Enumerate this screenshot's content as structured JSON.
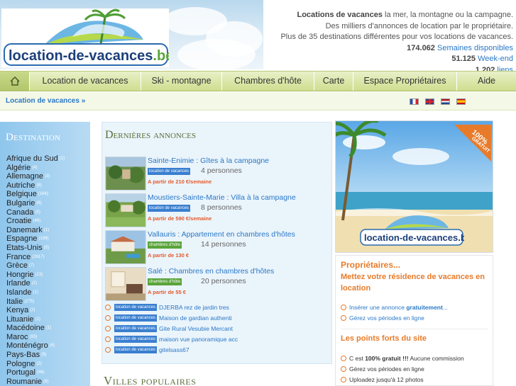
{
  "header": {
    "logo_text": "location-de-vacances.be",
    "tagline_strong": "Locations de vacances",
    "tagline_rest": " la mer, la montagne ou la campagne.",
    "line2": "Des milliers d'annonces de location par le propriétaire.",
    "line3": "Plus de 35 destinations différentes pour vos locations de vacances.",
    "stats": [
      {
        "num": "174.062",
        "label": "Semaines disponibles"
      },
      {
        "num": "51.125",
        "label": "Week-end"
      },
      {
        "num": "1.202",
        "label": "liens"
      }
    ]
  },
  "nav": {
    "home_icon": "home-icon",
    "items": [
      "Location de vacances",
      "Ski - montagne",
      "Chambres d'hôte",
      "Carte",
      "Espace Propriétaires",
      "Aide"
    ]
  },
  "breadcrumb": "Location de vacances »",
  "languages": [
    "fr",
    "en",
    "nl",
    "es"
  ],
  "sidebar": {
    "title": "Destination",
    "destinations": [
      {
        "name": "Afrique du Sud",
        "count": "(1)"
      },
      {
        "name": "Algérie",
        "count": "(4)"
      },
      {
        "name": "Allemagne",
        "count": "(3)"
      },
      {
        "name": "Autriche",
        "count": "(8)"
      },
      {
        "name": "Belgique",
        "count": "(164)"
      },
      {
        "name": "Bulgarie",
        "count": "(6)"
      },
      {
        "name": "Canada",
        "count": "(5)"
      },
      {
        "name": "Croatie",
        "count": "(48)"
      },
      {
        "name": "Danemark",
        "count": "(1)"
      },
      {
        "name": "Espagne",
        "count": "(189)"
      },
      {
        "name": "Etats-Unis",
        "count": "(5)"
      },
      {
        "name": "France",
        "count": "(2617)"
      },
      {
        "name": "Grèce",
        "count": "(7)"
      },
      {
        "name": "Hongrie",
        "count": "(13)"
      },
      {
        "name": "Irlande",
        "count": "(2)"
      },
      {
        "name": "Islande",
        "count": "(1)"
      },
      {
        "name": "Italie",
        "count": "(275)"
      },
      {
        "name": "Kenya",
        "count": "(2)"
      },
      {
        "name": "Lituanie",
        "count": "(1)"
      },
      {
        "name": "Macédoine",
        "count": "(1)"
      },
      {
        "name": "Maroc",
        "count": "(93)"
      },
      {
        "name": "Monténégro",
        "count": "(4)"
      },
      {
        "name": "Pays-Bas",
        "count": "(9)"
      },
      {
        "name": "Pologne",
        "count": "(2)"
      },
      {
        "name": "Portugal",
        "count": "(46)"
      },
      {
        "name": "Roumanie",
        "count": "(6)"
      }
    ]
  },
  "annonces": {
    "title": "Dernières annonces",
    "items": [
      {
        "title": "Sainte-Enimie : Gîtes à la campagne",
        "tag": "location de vacances",
        "persons": "4 personnes",
        "price": "A partir de 210 €/semaine"
      },
      {
        "title": "Moustiers-Sainte-Marie : Villa à la campagne",
        "tag": "location de vacances",
        "persons": "8 personnes",
        "price": "A partir de 590 €/semaine"
      },
      {
        "title": "Vallauris : Appartement en chambres d'hôtes",
        "tag": "chambres d'hôte",
        "persons": "14 personnes",
        "price": "A partir de 130 €"
      },
      {
        "title": "Salé : Chambres en chambres d'hôtes",
        "tag": "chambres d'hôte",
        "persons": "20 personnes",
        "price": "A partir de 55 €"
      }
    ],
    "mini": [
      {
        "tag": "location de vacances",
        "text": "DJERBA rez de jardin tres"
      },
      {
        "tag": "location de vacances",
        "text": "Maison de gardian authenti"
      },
      {
        "tag": "location de vacances",
        "text": "Gite Rural Vesubie Mercant"
      },
      {
        "tag": "location de vacances",
        "text": "maison vue panoramique acc"
      },
      {
        "tag": "location de vacances",
        "text": "gitelsass67"
      }
    ]
  },
  "villes_title": "Villes populaires",
  "promo": {
    "badge_line1": "100%",
    "badge_line2": "GRATUIT",
    "logo_text": "location-de-vacances.be"
  },
  "owners": {
    "title": "Propriétaires...",
    "subtitle": "Mettez votre résidence de vacances en location",
    "insert_pre": "Insérer une annonce ",
    "insert_bold": "gratuitement",
    "insert_post": "...",
    "manage": "Gérez vos périodes en ligne",
    "forts_title": "Les points forts du site",
    "forts": [
      {
        "pre": "C est ",
        "bold": "100% gratuit !!!",
        "post": " Aucune commission"
      },
      {
        "pre": "Gérez vos périodes en ligne",
        "bold": "",
        "post": ""
      },
      {
        "pre": "Uploadez jusqu'à 12 photos",
        "bold": "",
        "post": ""
      }
    ]
  }
}
